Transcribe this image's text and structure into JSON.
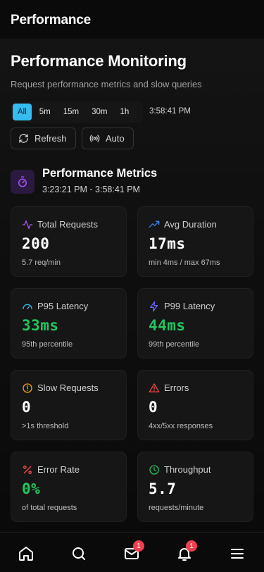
{
  "app": {
    "title": "Performance"
  },
  "page": {
    "title": "Performance Monitoring",
    "subtitle": "Request performance metrics and slow queries"
  },
  "ranges": [
    "All",
    "5m",
    "15m",
    "30m",
    "1h"
  ],
  "selected_range": "All",
  "current_time": "3:58:41 PM",
  "actions": {
    "refresh": "Refresh",
    "auto": "Auto"
  },
  "metrics": {
    "title": "Performance Metrics",
    "range": "3:23:21 PM - 3:58:41 PM",
    "cards": [
      {
        "label": "Total Requests",
        "value": "200",
        "sub": "5.7 req/min",
        "icon": "activity-icon"
      },
      {
        "label": "Avg Duration",
        "value": "17ms",
        "sub": "min 4ms / max 67ms",
        "icon": "trending-up-icon"
      },
      {
        "label": "P95 Latency",
        "value": "33ms",
        "sub": "95th percentile",
        "icon": "gauge-icon"
      },
      {
        "label": "P99 Latency",
        "value": "44ms",
        "sub": "99th percentile",
        "icon": "lightning-icon"
      },
      {
        "label": "Slow Requests",
        "value": "0",
        "sub": ">1s threshold",
        "icon": "alert-circle-icon"
      },
      {
        "label": "Errors",
        "value": "0",
        "sub": "4xx/5xx responses",
        "icon": "warning-triangle-icon"
      },
      {
        "label": "Error Rate",
        "value": "0%",
        "sub": "of total requests",
        "icon": "percent-icon"
      },
      {
        "label": "Throughput",
        "value": "5.7",
        "sub": "requests/minute",
        "icon": "clock-icon"
      }
    ]
  },
  "nav": {
    "items": [
      "home-icon",
      "search-icon",
      "mail-icon",
      "bell-icon",
      "menu-icon"
    ],
    "mail_badge": "1",
    "bell_badge": "1"
  },
  "colors": {
    "accent": "#35bdf0",
    "green": "#22c55e",
    "purple": "#a855f7",
    "blue": "#3b82f6",
    "amber": "#f59e0b",
    "red": "#ef4444",
    "badge": "#f04050"
  }
}
